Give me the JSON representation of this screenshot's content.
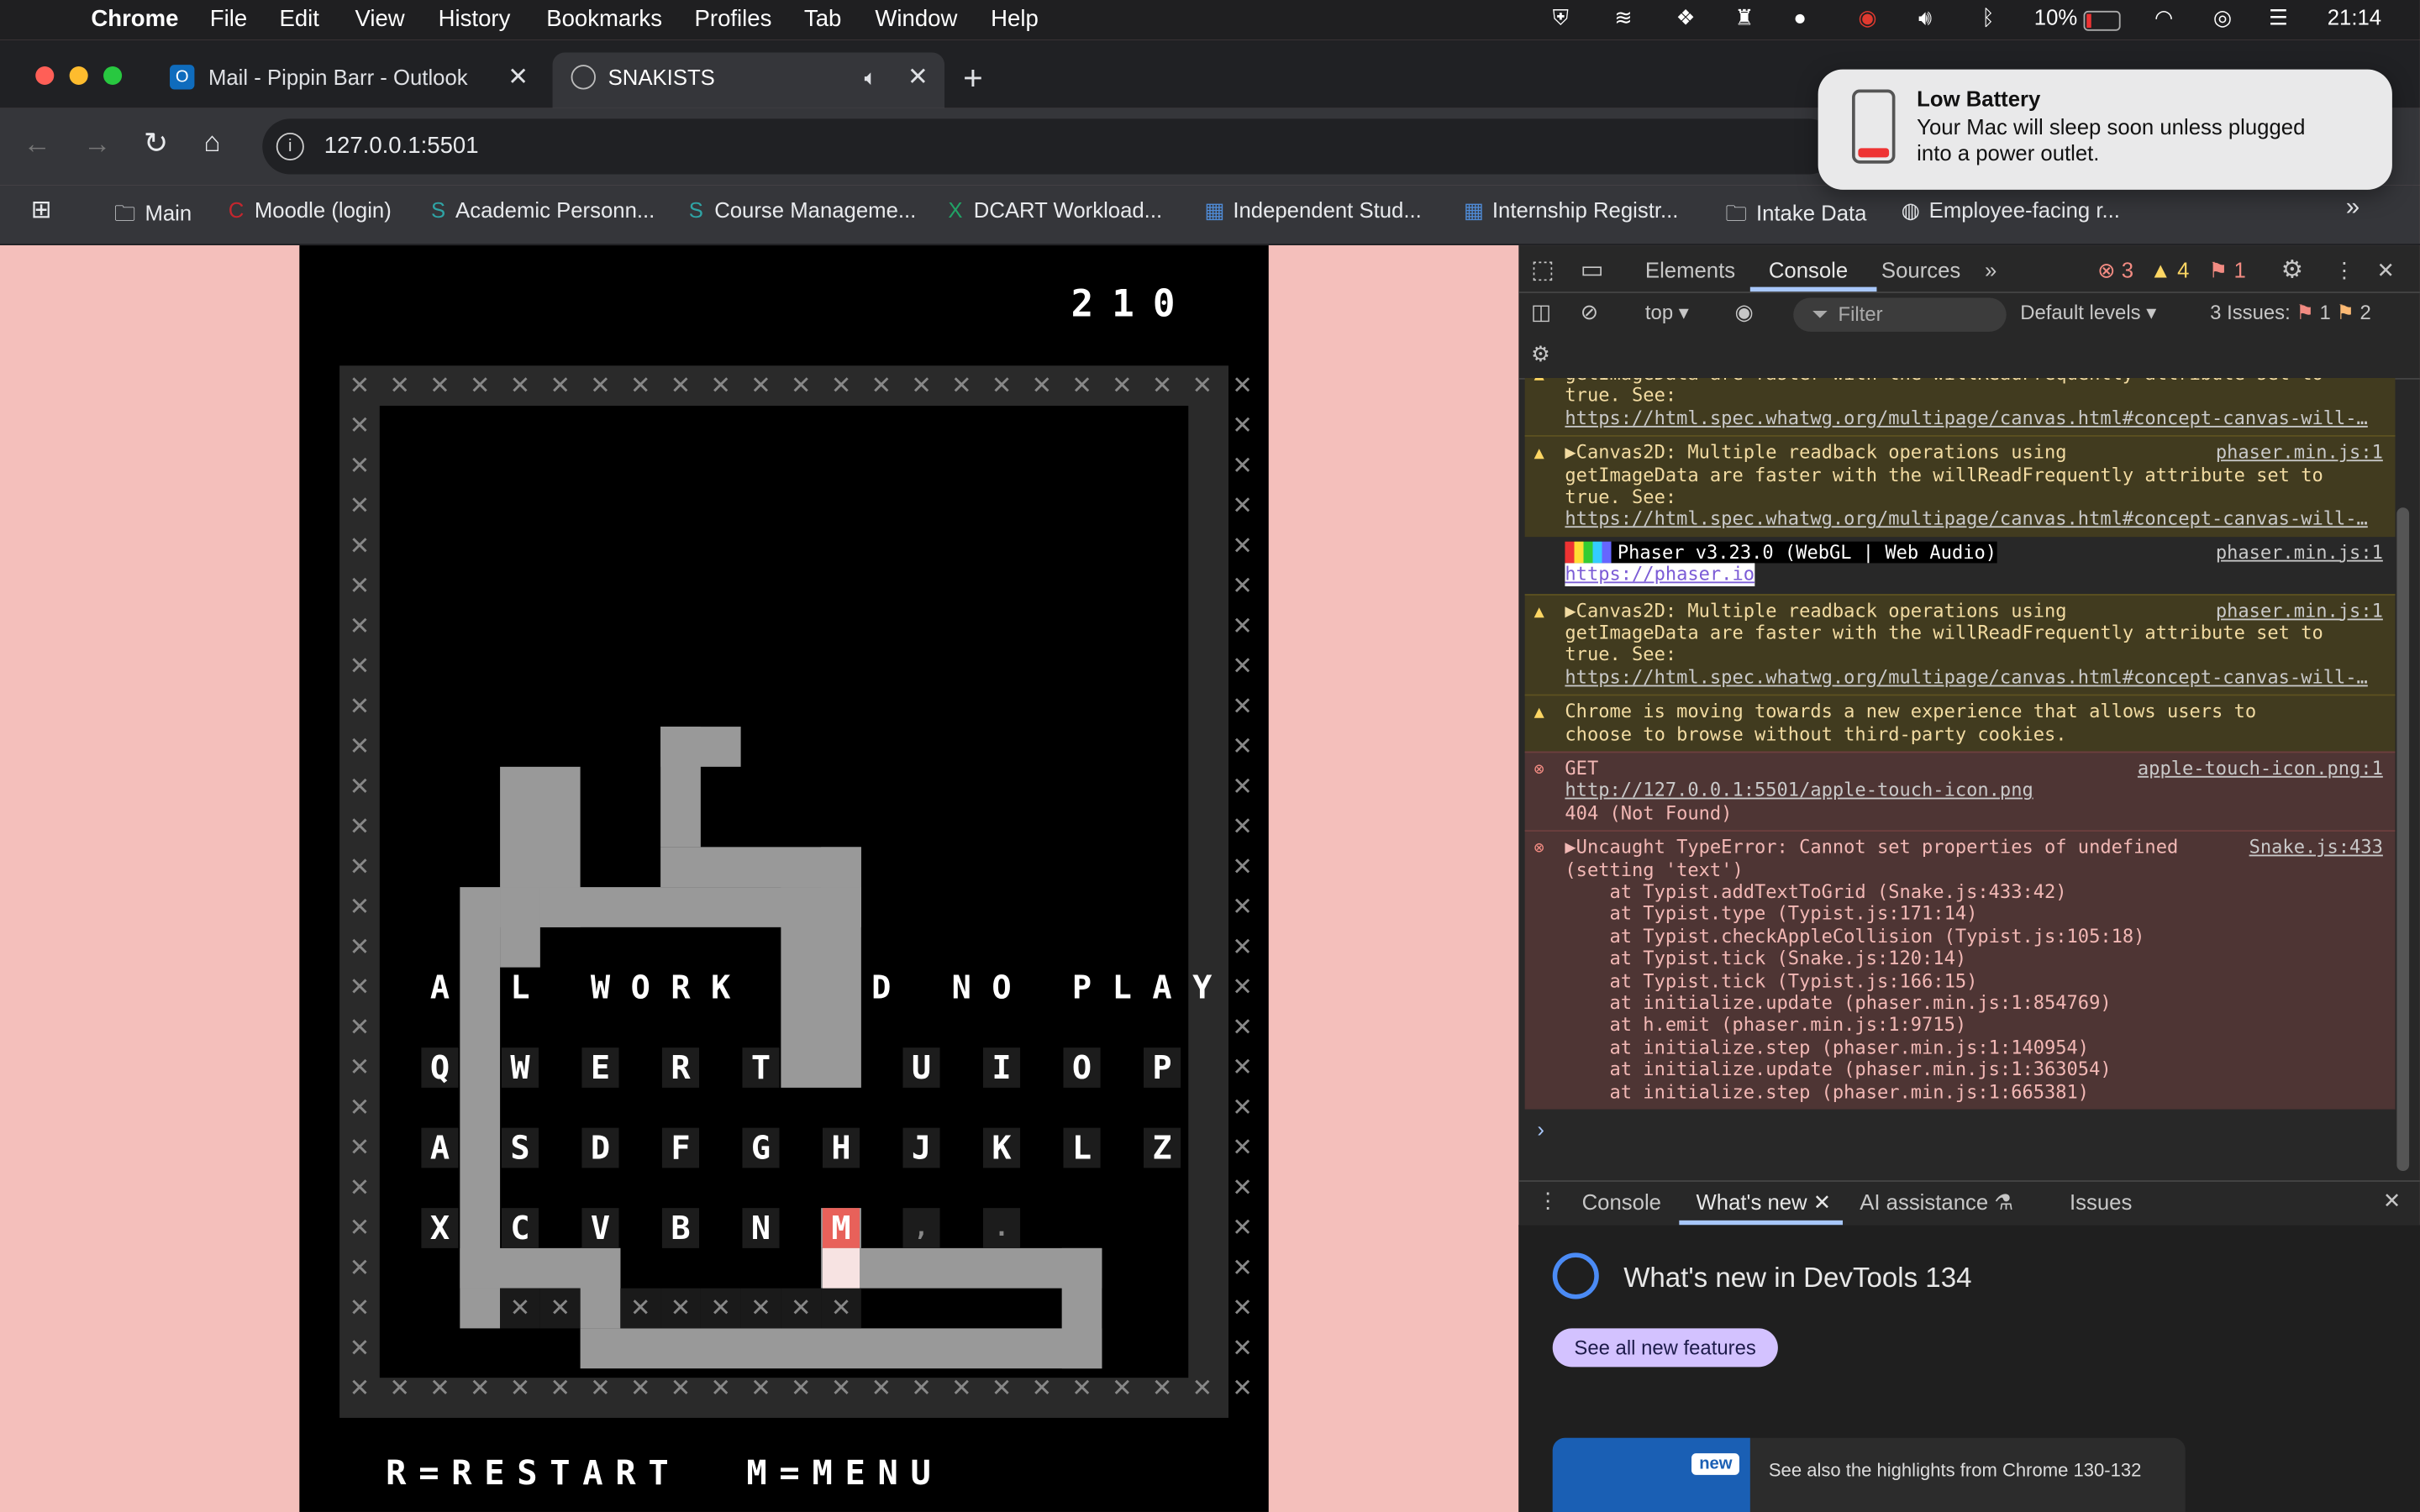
{
  "menubar": {
    "app": "Chrome",
    "items": [
      "File",
      "Edit",
      "View",
      "History",
      "Bookmarks",
      "Profiles",
      "Tab",
      "Window",
      "Help"
    ],
    "battery": "10%",
    "time": "21:14"
  },
  "tabs": [
    {
      "title": "Mail - Pippin Barr - Outlook"
    },
    {
      "title": "SNAKISTS"
    }
  ],
  "address": {
    "url": "127.0.0.1:5501"
  },
  "bookmarks": [
    "Main",
    "Moodle (login)",
    "Academic Personn...",
    "Course Manageme...",
    "DCART Workload...",
    "Independent Stud...",
    "Internship Registr...",
    "Intake Data",
    "Employee-facing r..."
  ],
  "notification": {
    "title": "Low Battery",
    "body_line1": "Your Mac will sleep soon unless plugged",
    "body_line2": "into a power outlet."
  },
  "game": {
    "score": "210",
    "phrase": "A L  WORK  D NO PLAY",
    "phrase_visible": [
      "A",
      "L",
      "W",
      "O",
      "R",
      "K",
      "D",
      "N",
      "O",
      "P",
      "L",
      "A",
      "Y"
    ],
    "rows": [
      [
        "Q",
        "W",
        "E",
        "R",
        "T",
        "",
        "U",
        "I",
        "O",
        "P"
      ],
      [
        "A",
        "S",
        "D",
        "F",
        "G",
        "H",
        "J",
        "K",
        "L",
        "Z"
      ],
      [
        "X",
        "C",
        "V",
        "B",
        "N",
        "M",
        ",",
        "."
      ]
    ],
    "highlight_key": "M",
    "footer": "R=RESTART  M=MENU"
  },
  "devtools": {
    "tabs": [
      "Elements",
      "Console",
      "Sources"
    ],
    "error_count": "3",
    "warn_count": "4",
    "issue_count": "1",
    "context": "top",
    "filter_placeholder": "Filter",
    "levels": "Default levels",
    "issues_label": "3 Issues:",
    "issues_err": "1",
    "issues_warn": "2",
    "messages": [
      {
        "type": "warn",
        "lines": [
          "getImageData are faster with the willReadFrequently attribute set to",
          "true. See:",
          "https://html.spec.whatwg.org/multipage/canvas.html#concept-canvas-will-…"
        ],
        "source": ""
      },
      {
        "type": "warn",
        "lines": [
          "▶Canvas2D: Multiple readback operations using",
          "getImageData are faster with the willReadFrequently attribute set to",
          "true. See:",
          "https://html.spec.whatwg.org/multipage/canvas.html#concept-canvas-will-…"
        ],
        "source": "phaser.min.js:1"
      },
      {
        "type": "info",
        "lines": [
          "Phaser v3.23.0 (WebGL | Web Audio)",
          "https://phaser.io"
        ],
        "source": "phaser.min.js:1"
      },
      {
        "type": "warn",
        "lines": [
          "▶Canvas2D: Multiple readback operations using",
          "getImageData are faster with the willReadFrequently attribute set to",
          "true. See:",
          "https://html.spec.whatwg.org/multipage/canvas.html#concept-canvas-will-…"
        ],
        "source": "phaser.min.js:1"
      },
      {
        "type": "warn",
        "lines": [
          "Chrome is moving towards a new experience that allows users to",
          "choose to browse without third-party cookies."
        ],
        "source": ""
      },
      {
        "type": "err",
        "lines": [
          "GET",
          "http://127.0.0.1:5501/apple-touch-icon.png",
          "404 (Not Found)"
        ],
        "source": "apple-touch-icon.png:1"
      },
      {
        "type": "err",
        "lines": [
          "▶Uncaught TypeError: Cannot set properties of undefined",
          "(setting 'text')",
          "    at Typist.addTextToGrid (Snake.js:433:42)",
          "    at Typist.type (Typist.js:171:14)",
          "    at Typist.checkAppleCollision (Typist.js:105:18)",
          "    at Typist.tick (Snake.js:120:14)",
          "    at Typist.tick (Typist.js:166:15)",
          "    at initialize.update (phaser.min.js:1:854769)",
          "    at h.emit (phaser.min.js:1:9715)",
          "    at initialize.step (phaser.min.js:1:140954)",
          "    at initialize.update (phaser.min.js:1:363054)",
          "    at initialize.step (phaser.min.js:1:665381)"
        ],
        "source": "Snake.js:433"
      }
    ],
    "drawer_tabs": [
      "Console",
      "What's new",
      "AI assistance",
      "Issues"
    ],
    "whatsnew_title": "What's new in DevTools 134",
    "see_all": "See all new features",
    "highlights": "See also the highlights from Chrome 130-132",
    "new_badge": "new"
  }
}
